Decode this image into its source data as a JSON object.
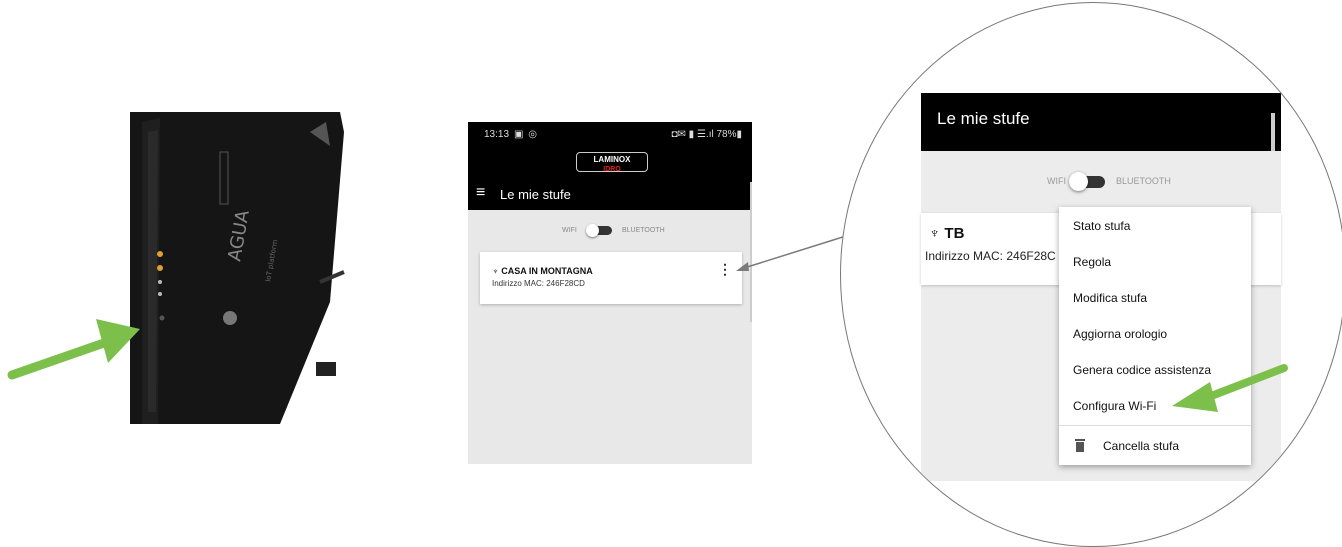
{
  "phone": {
    "status_time": "13:13",
    "status_left_icons": "▣ ◎",
    "status_right": "◘✉ ▮ ☰.ıl 78%▮",
    "logo_top": "LAMINOX",
    "logo_bottom": "IDRO",
    "app_title": "Le mie stufe",
    "toggle_wifi": "WIFI",
    "toggle_bluetooth": "BLUETOOTH",
    "stove_name": "CASA IN MONTAGNA",
    "stove_mac": "Indirizzo MAC: 246F28CD",
    "more_icon": "⋮"
  },
  "zoom": {
    "app_title": "Le mie stufe",
    "toggle_wifi": "WIFI",
    "toggle_bluetooth": "BLUETOOTH",
    "stove_name": "TB",
    "stove_mac": "Indirizzo MAC: 246F28C",
    "menu_items": [
      "Stato stufa",
      "Regola",
      "Modifica stufa",
      "Aggiorna orologio",
      "Genera codice assistenza",
      "Configura Wi-Fi",
      "Cancella stufa"
    ]
  },
  "colors": {
    "arrow_green": "#7cc04b",
    "appbar": "#000000",
    "background": "#e8e8e8"
  }
}
